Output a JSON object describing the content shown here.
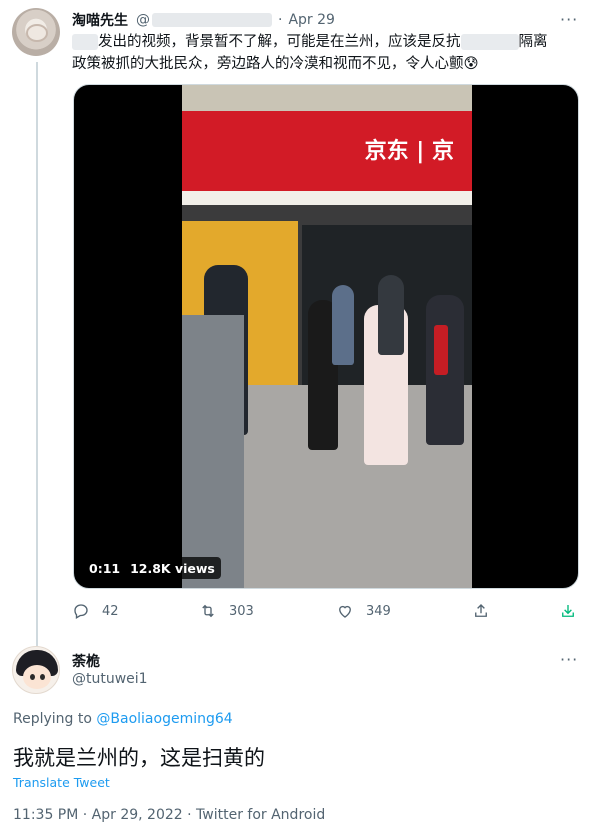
{
  "tweet1": {
    "name": "淘喵先生",
    "handle": "@",
    "date": "Apr 29",
    "text_line1_a": "发出的视频，背景暂不了解，可能是在兰州，应该是反抗",
    "text_line1_b": "隔离",
    "text_line2": "政策被抓的大批民众，旁边路人的冷漠和视而不见，令人心颤😰",
    "sign_text": "京东 | 京",
    "video_time": "0:11",
    "video_views": "12.8K views",
    "replies": "42",
    "retweets": "303",
    "likes": "349"
  },
  "tweet2": {
    "name": "荼桅",
    "handle": "@tutuwei1",
    "replying_prefix": "Replying to",
    "replying_to": "@Baoliaogeming64",
    "text": "我就是兰州的，这是扫黄的",
    "translate": "Translate Tweet",
    "meta": "11:35 PM · Apr 29, 2022 · Twitter for Android"
  },
  "icons": [
    "reply-icon",
    "retweet-icon",
    "like-icon",
    "share-icon",
    "download-icon",
    "more-icon"
  ],
  "colors": {
    "link": "#1d9bf0",
    "secondary": "#536471",
    "text": "#0f1419"
  }
}
